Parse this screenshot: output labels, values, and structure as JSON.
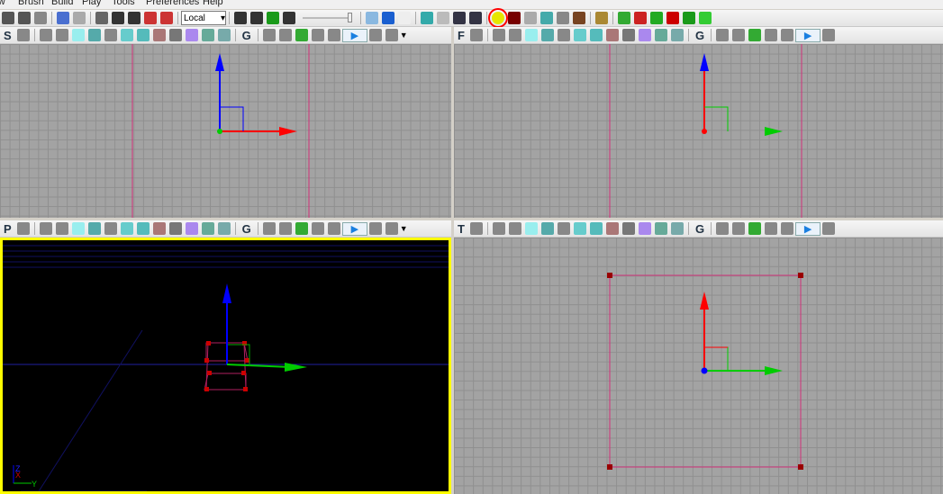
{
  "menu": [
    "View",
    "Brush",
    "Build",
    "Play",
    "Tools",
    "Preferences",
    "Help"
  ],
  "main_toolbar": {
    "coord_system": "Local",
    "icons_left": [
      "save-icon",
      "save-all-icon",
      "copy-icon",
      "undo-icon",
      "redo-icon",
      "select-icon",
      "translate-icon",
      "rotate-icon",
      "scale-icon",
      "scale-nonuniform-icon"
    ],
    "icons_mid": [
      "find-icon",
      "kismet-icon",
      "k-icon",
      "clapper-icon"
    ],
    "icons_right": [
      "content-browser-icon",
      "generic-browser-icon",
      "star-icon",
      "shield-icon",
      "light-icon",
      "path-icon",
      "path-remove-icon",
      "build-highlighted-icon",
      "build-all-icon",
      "lighting-icon",
      "paths-icon",
      "geometry-icon",
      "cover-icon",
      "matinee-icon",
      "actor-icon",
      "play-console-icon",
      "mobile-icon",
      "pc-icon",
      "kismet-record-icon",
      "play-in-editor-icon"
    ],
    "highlight_color": "#ff0000"
  },
  "viewports": [
    {
      "id": "side",
      "letter": "S"
    },
    {
      "id": "front",
      "letter": "F"
    },
    {
      "id": "perspective",
      "letter": "P",
      "axes": [
        "Z",
        "X",
        "Y"
      ]
    },
    {
      "id": "top",
      "letter": "T"
    }
  ],
  "vp_icons": [
    "wireframe-icon",
    "brush-wire-icon",
    "unlit-icon",
    "lit-icon",
    "detail-lighting-icon",
    "lighting-only-icon",
    "light-complexity-icon",
    "texture-density-icon",
    "shader-complexity-icon",
    "lightmap-density-icon",
    "light-map-icon",
    "reflection-icon"
  ],
  "colors": {
    "accent_yellow": "#ffff00",
    "grid": "#a3a3a3",
    "axis_x": "#ff0000",
    "axis_y": "#00cc00",
    "axis_z": "#0000ff"
  }
}
